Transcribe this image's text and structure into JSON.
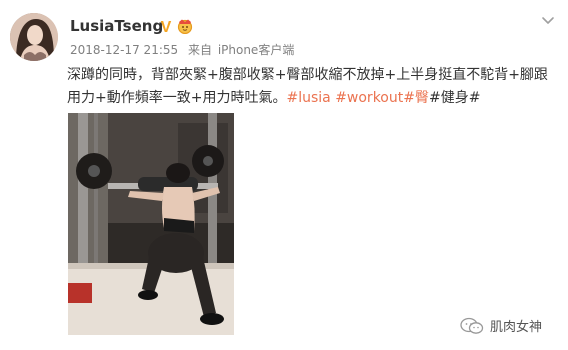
{
  "post": {
    "username": "LusiaTseng",
    "timestamp": "2018-12-17 21:55",
    "source_prefix": "来自",
    "source_device": "iPhone客户端",
    "text_main": "深蹲的同時，背部夾緊+腹部收緊+臀部收縮不放掉+上半身挺直不駝背+腳跟用力+動作頻率一致+用力時吐氣。",
    "tags": [
      "#lusia",
      "#workout",
      "#臀",
      "#健身#"
    ]
  },
  "badges": {
    "verified_letter": "V"
  },
  "watermark": {
    "text": "肌肉女神"
  },
  "colors": {
    "tag": "#eb7350",
    "verified": "#f5a623"
  }
}
